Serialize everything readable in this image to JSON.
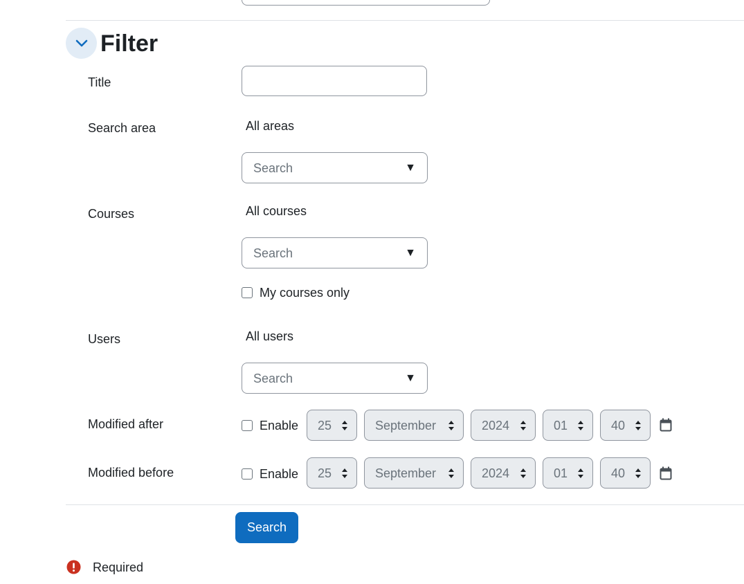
{
  "section": {
    "title": "Filter"
  },
  "fields": {
    "title": {
      "label": "Title",
      "value": ""
    },
    "search_area": {
      "label": "Search area",
      "selection": "All areas",
      "placeholder": "Search",
      "arrow": "▼"
    },
    "courses": {
      "label": "Courses",
      "selection": "All courses",
      "placeholder": "Search",
      "arrow": "▼",
      "my_courses_only": "My courses only"
    },
    "users": {
      "label": "Users",
      "selection": "All users",
      "placeholder": "Search",
      "arrow": "▼"
    },
    "modified_after": {
      "label": "Modified after",
      "enable": "Enable",
      "day": "25",
      "month": "September",
      "year": "2024",
      "hour": "01",
      "minute": "40"
    },
    "modified_before": {
      "label": "Modified before",
      "enable": "Enable",
      "day": "25",
      "month": "September",
      "year": "2024",
      "hour": "01",
      "minute": "40"
    }
  },
  "actions": {
    "search_label": "Search"
  },
  "footer": {
    "required_label": "Required"
  },
  "colors": {
    "primary": "#0f6cbf",
    "required": "#ca3120"
  }
}
